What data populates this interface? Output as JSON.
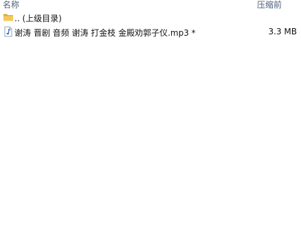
{
  "columns": {
    "name": "名称",
    "size": "压缩前"
  },
  "rows": [
    {
      "icon": "folder-icon",
      "name": ".. (上级目录)",
      "size": ""
    },
    {
      "icon": "audio-file-icon",
      "name": "谢涛 晋剧 音频 谢涛 打金枝 金殿劝郭子仪.mp3 *",
      "size": "3.3 MB"
    }
  ],
  "colors": {
    "header_text": "#4c5e7a",
    "folder_yellow": "#e8b84a",
    "audio_icon_blue": "#2a6fb8"
  }
}
